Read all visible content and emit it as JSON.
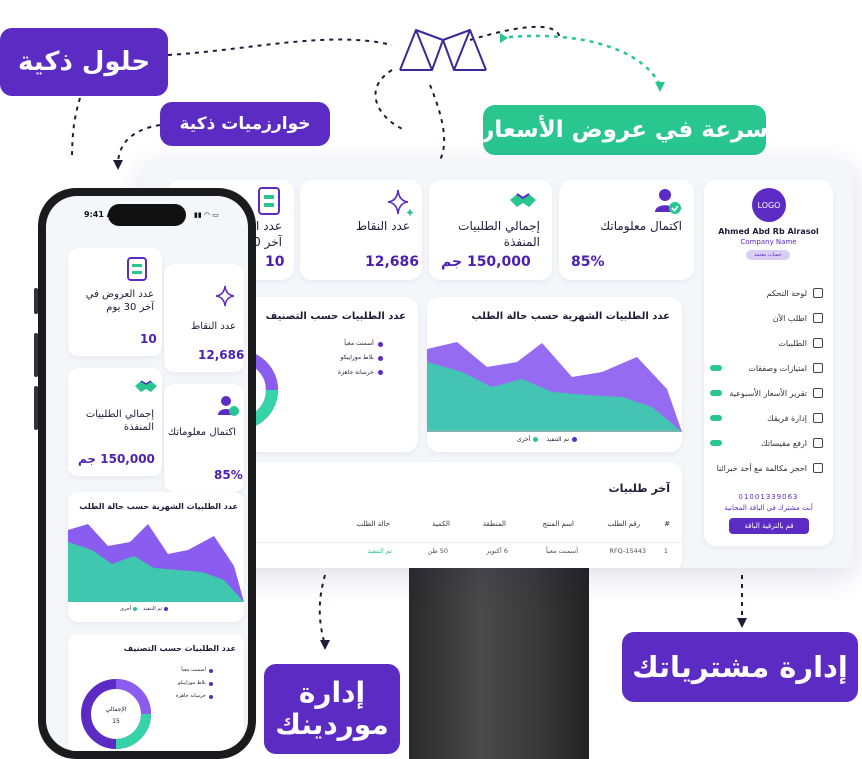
{
  "labels": {
    "smart_solutions": "حلول ذكية",
    "smart_algorithms": "خوارزميات ذكية",
    "fast_quotes": "سرعة في عروض الأسعار",
    "manage_purchases": "إدارة مشترياتك",
    "manage_suppliers_1": "إدارة",
    "manage_suppliers_2": "موردينك"
  },
  "colors": {
    "brand_purple": "#5b2bc4",
    "brand_green": "#29c690",
    "value_purple": "#4b1fb0"
  },
  "sidebar": {
    "logo_text": "LOGO",
    "user_name": "Ahmed Abd Rb Alrasol",
    "company_name": "Company Name",
    "account_chip": "حساب معتمد",
    "items": [
      {
        "label": "لوحة التحكم",
        "icon": "dashboard-icon",
        "new": false
      },
      {
        "label": "اطلب الآن",
        "icon": "cart-icon",
        "new": false
      },
      {
        "label": "الطلبيات",
        "icon": "orders-icon",
        "new": false
      },
      {
        "label": "امتيازات وصفقات",
        "icon": "deals-icon",
        "new": true
      },
      {
        "label": "تقرير الأسعار الأسبوعية",
        "icon": "report-icon",
        "new": true
      },
      {
        "label": "إدارة فريقك",
        "icon": "team-icon",
        "new": true
      },
      {
        "label": "ارفع مقيساتك",
        "icon": "upload-icon",
        "new": true
      },
      {
        "label": "احجز مكالمة مع أحد خبرائنا",
        "icon": "phone-icon",
        "new": false
      }
    ],
    "phone_number": "01001339063",
    "free_plan_text": "أنت مشترك في الباقة المجانية",
    "upgrade_button": "قم بالترقية الباقة"
  },
  "stats": [
    {
      "title": "اكتمال معلوماتك",
      "value": "85%",
      "icon": "user-check-icon"
    },
    {
      "title": "إجمالي الطلبيات المنفذة",
      "value": "150,000 جم",
      "icon": "handshake-icon"
    },
    {
      "title": "عدد النقاط",
      "value": "12,686",
      "icon": "sparkle-icon"
    },
    {
      "title": "عدد العروض في آخر 30 يوم",
      "value": "10",
      "icon": "offers-icon"
    }
  ],
  "monthly_chart": {
    "title": "عدد الطلبيات الشهرية حسب حالة الطلب",
    "legend": [
      "تم التنفيذ",
      "أخرى"
    ]
  },
  "category_chart": {
    "title": "عدد الطلبيات حسب التصنيف",
    "legend": [
      "أسمنت معبأ",
      "بلاط موزاييكو",
      "خرسانة جاهزة"
    ],
    "total_label": "الإجمالي",
    "total_value": "15"
  },
  "orders": {
    "title": "آخر طلبيات",
    "columns": [
      "#",
      "رقم الطلب",
      "اسم المنتج",
      "المنطقة",
      "الكمية",
      "حالة الطلب"
    ],
    "rows": [
      {
        "num": "1",
        "order": "RFQ-15443",
        "product": "أسمنت معبأ",
        "area": "6 أكتوبر",
        "qty": "50 طن",
        "status": "تم التنفيذ"
      }
    ]
  },
  "phone": {
    "time": "9:41 AM"
  }
}
